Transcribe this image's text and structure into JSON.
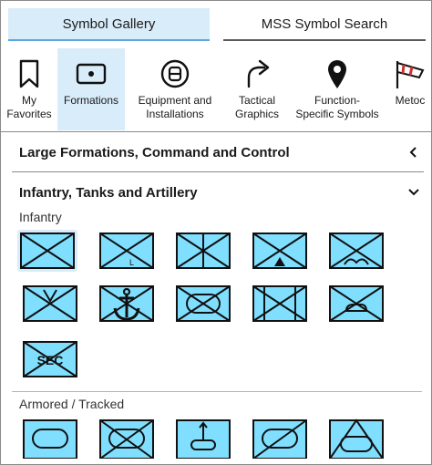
{
  "tabs": [
    {
      "label": "Symbol Gallery",
      "active": true
    },
    {
      "label": "MSS Symbol Search",
      "active": false
    }
  ],
  "categories": [
    {
      "label": "My\nFavorites",
      "icon": "bookmark-icon"
    },
    {
      "label": "Formations",
      "icon": "formation-icon",
      "active": true
    },
    {
      "label": "Equipment and\nInstallations",
      "icon": "equipment-icon"
    },
    {
      "label": "Tactical\nGraphics",
      "icon": "curved-arrow-icon"
    },
    {
      "label": "Function-\nSpecific Symbols",
      "icon": "map-pin-icon"
    },
    {
      "label": "Metoc",
      "icon": "windsock-icon"
    }
  ],
  "sections": [
    {
      "title": "Large Formations, Command and Control",
      "expanded": false
    },
    {
      "title": "Infantry, Tanks and Artillery",
      "expanded": true
    }
  ],
  "groups": {
    "infantry": "Infantry",
    "armored": "Armored / Tracked"
  },
  "symbol_text": {
    "l": "L",
    "sec": "SEC"
  },
  "colors": {
    "accent_bg": "#d9ecf9",
    "accent_line": "#5aa7dc",
    "symbol_fill": "#80dfff"
  }
}
